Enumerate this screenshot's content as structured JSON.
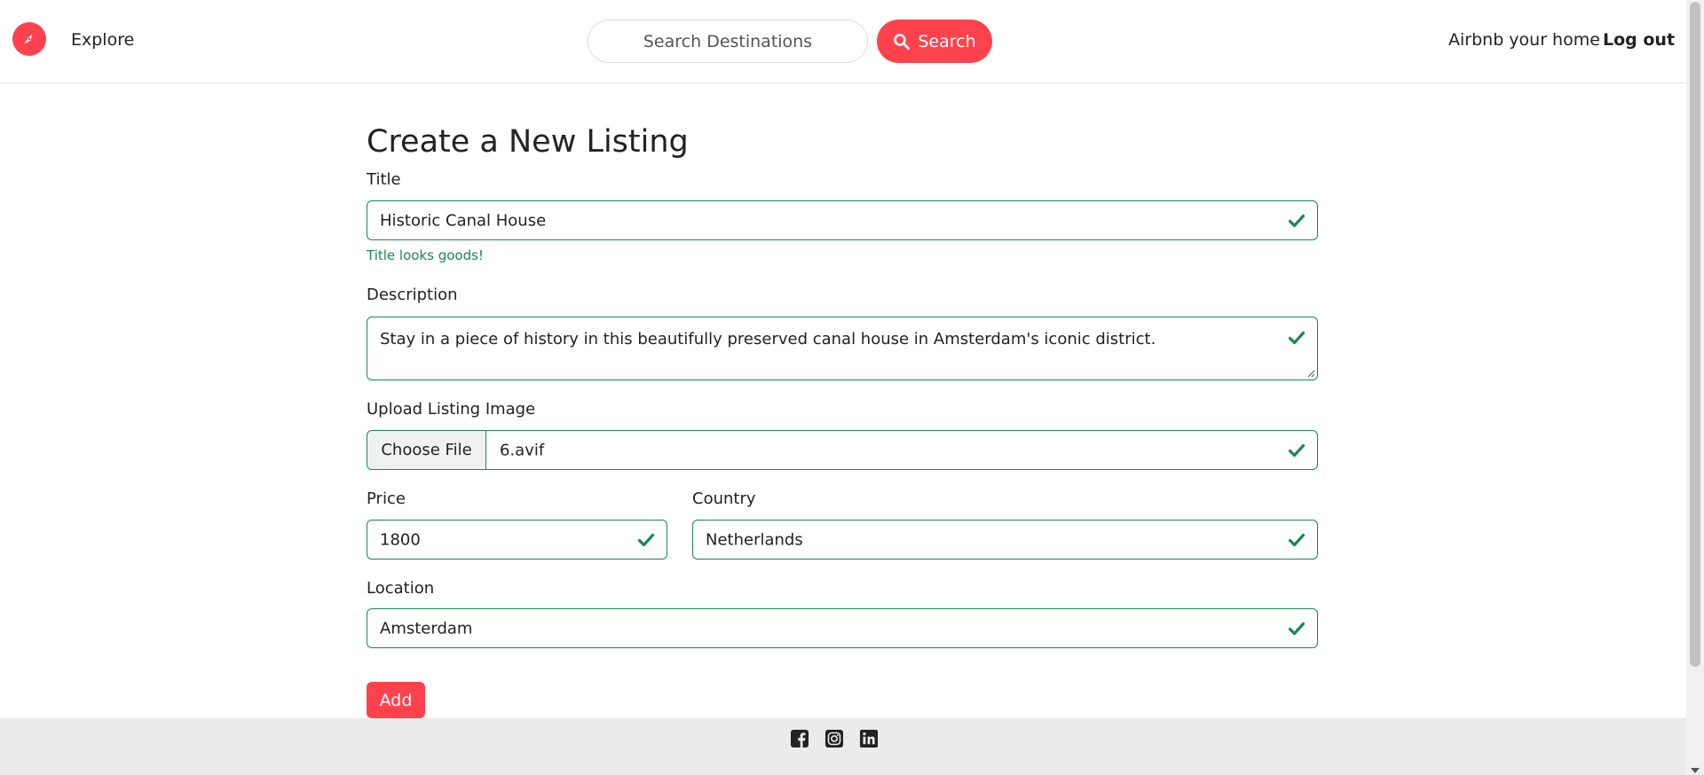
{
  "nav": {
    "explore_label": "Explore",
    "search_placeholder": "Search Destinations",
    "search_button_label": "Search",
    "host_label": "Airbnb your home",
    "logout_label": "Log out",
    "brand_icon": "compass-icon",
    "accent_color": "#fe424d"
  },
  "form": {
    "heading": "Create a New Listing",
    "title": {
      "label": "Title",
      "value": "Historic Canal House",
      "feedback": "Title looks goods!"
    },
    "description": {
      "label": "Description",
      "value": "Stay in a piece of history in this beautifully preserved canal house in Amsterdam's iconic district."
    },
    "image": {
      "label": "Upload Listing Image",
      "button_label": "Choose File",
      "file_name": "6.avif"
    },
    "price": {
      "label": "Price",
      "value": "1800"
    },
    "country": {
      "label": "Country",
      "value": "Netherlands"
    },
    "location": {
      "label": "Location",
      "value": "Amsterdam"
    },
    "submit_label": "Add",
    "valid_color": "#198754"
  },
  "footer": {
    "social_icons": [
      "facebook-icon",
      "instagram-icon",
      "linkedin-icon"
    ]
  }
}
